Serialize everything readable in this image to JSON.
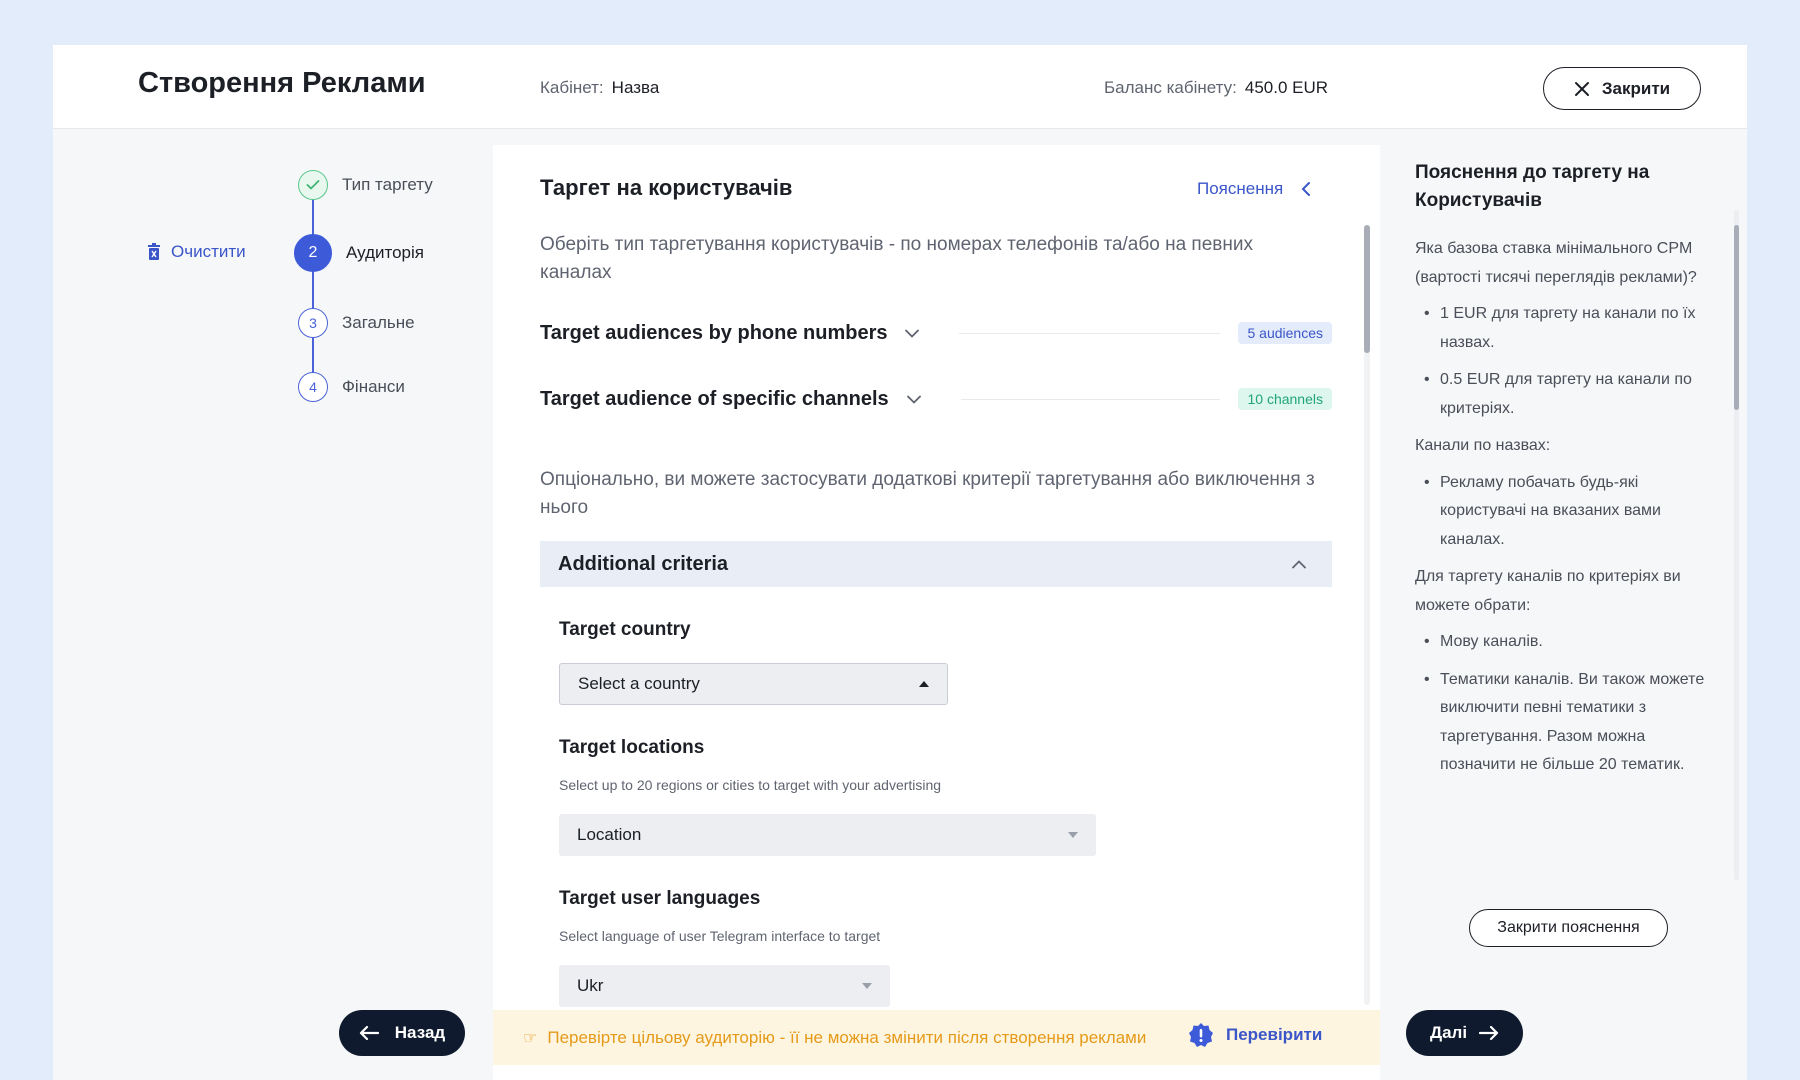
{
  "header": {
    "title": "Створення Реклами",
    "cabinet_label": "Кабінет:",
    "cabinet_value": "Назва",
    "balance_label": "Баланс кабінету:",
    "balance_value": "450.0 EUR",
    "close_label": "Закрити"
  },
  "sidebar": {
    "clear_label": "Очистити",
    "steps": [
      {
        "number": "",
        "label": "Тип таргету",
        "state": "done"
      },
      {
        "number": "2",
        "label": "Аудиторія",
        "state": "active"
      },
      {
        "number": "3",
        "label": "Загальне",
        "state": "pending"
      },
      {
        "number": "4",
        "label": "Фінанси",
        "state": "pending"
      }
    ]
  },
  "main": {
    "title": "Таргет на користувачів",
    "explain_link": "Пояснення",
    "intro": "Оберіть тип таргетування користувачів - по номерах телефонів та/або на певних каналах",
    "accordions": [
      {
        "title": "Target audiences by phone numbers",
        "badge": "5 audiences"
      },
      {
        "title": "Target audience of specific channels",
        "badge": "10 channels"
      }
    ],
    "optional_text": "Опціонально, ви можете застосувати додаткові критерії таргетування або виключення з нього",
    "additional_title": "Additional criteria",
    "country": {
      "label": "Target country",
      "placeholder": "Select a country"
    },
    "locations": {
      "label": "Target locations",
      "hint": "Select up to 20 regions or cities to target with your advertising",
      "placeholder": "Location"
    },
    "languages": {
      "label": "Target user languages",
      "hint": "Select language of user Telegram interface to target",
      "value": "Ukr"
    }
  },
  "footer": {
    "back_label": "Назад",
    "warning": "Перевірте цільову аудиторію - її не можна змінити після створення реклами",
    "check_label": "Перевірити",
    "next_label": "Далі"
  },
  "explain_panel": {
    "title": "Пояснення до таргету на Користувачів",
    "question": "Яка базова ставка мінімального CPM (вартості тисячі переглядів реклами)?",
    "rates": [
      "1 EUR для таргету на канали по їх назвах.",
      "0.5 EUR для таргету на канали по критеріях."
    ],
    "by_name_heading": "Канали по назвах:",
    "by_name_items": [
      "Рекламу побачать будь-які користувачі на вказаних вами каналах."
    ],
    "criteria_heading": "Для таргету каналів по критеріях ви можете обрати:",
    "criteria_items": [
      "Мову каналів.",
      "Тематики каналів. Ви також можете виключити певні тематики з таргетування. Разом можна позначити не більше 20 тематик."
    ],
    "close_label": "Закрити пояснення"
  },
  "colors": {
    "accent": "#3d5bd9",
    "dark_button": "#0f1a2e",
    "warning_bg": "#fdf5df",
    "warning_text": "#e59a1a",
    "success": "#5ac68a"
  }
}
